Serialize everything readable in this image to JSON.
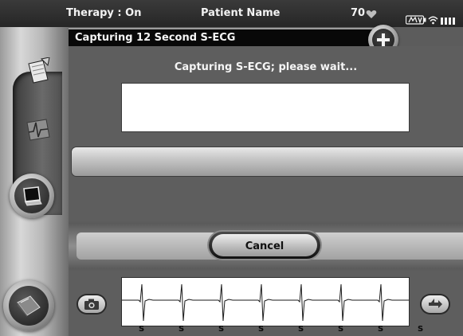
{
  "status_bar": {
    "therapy": "Therapy : On",
    "patient": "Patient Name",
    "heart_rate": "70",
    "icons": [
      "heart-icon",
      "battery-icon",
      "wifi-icon",
      "signal-icon"
    ]
  },
  "title_bar": {
    "title": "Capturing 12 Second S-ECG",
    "add_icon": "plus-icon"
  },
  "sidebar": {
    "items": [
      {
        "icon": "notes-icon"
      },
      {
        "icon": "ecg-strip-icon"
      },
      {
        "icon": "monitor-icon",
        "selected": true
      },
      {
        "icon": "home-icon"
      }
    ]
  },
  "main": {
    "status_message": "Capturing S-ECG; please wait...",
    "message_box_text": "",
    "progress": 0
  },
  "actions": {
    "cancel_label": "Cancel"
  },
  "ecg_strip": {
    "beat_labels": [
      "S",
      "S",
      "S",
      "S",
      "S",
      "S",
      "S",
      "S"
    ],
    "left_button_icon": "camera-icon",
    "right_button_icon": "marker-icon"
  },
  "colors": {
    "background": "#5e5e5e",
    "title_bar": "#080808",
    "text_light": "#f5f5f5"
  }
}
